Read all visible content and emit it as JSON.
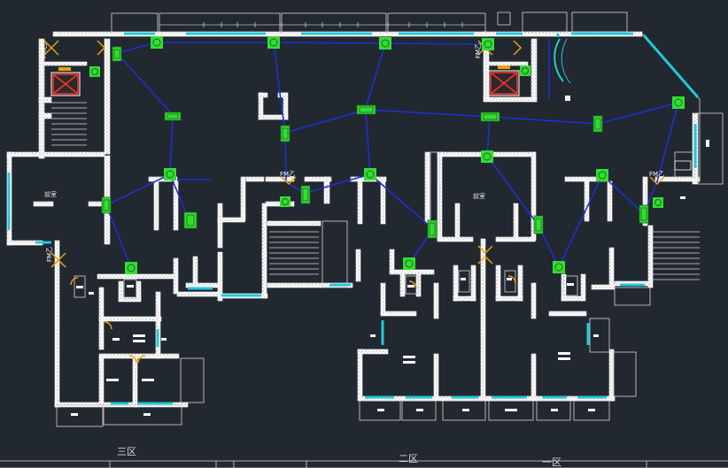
{
  "zones": {
    "zone3": "三区",
    "zone2": "二区",
    "zone1": "一区"
  },
  "fire_door_labels": {
    "left_top": "FM乙",
    "left_mid": "FM乙",
    "right_top": "FM乙",
    "center_left": "FM乙",
    "right_lower": "FM乙"
  },
  "room_labels": {
    "left_hall": "前室",
    "center_hall": "前室"
  },
  "colors": {
    "background": "#212830",
    "walls": "#ffffff",
    "windows": "#22c7d8",
    "wiring": "#1f2fd0",
    "devices": "#33dd33",
    "doors": "#f0a000",
    "elevator": "#ff3030"
  },
  "icons": {
    "device": "smoke-detector-icon",
    "module": "module-icon",
    "door": "fire-door-icon",
    "elevator": "elevator-icon"
  }
}
